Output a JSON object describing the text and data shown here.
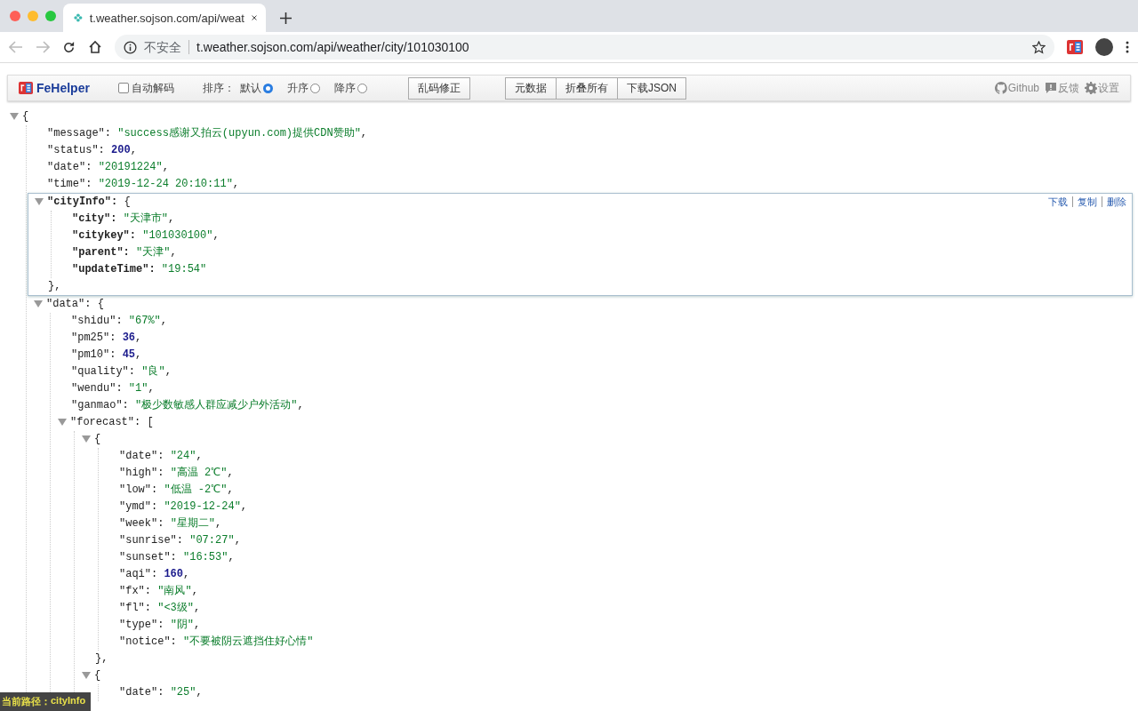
{
  "browser": {
    "tab": {
      "title": "t.weather.sojson.com/api/weat"
    },
    "security": "不安全",
    "url": "t.weather.sojson.com/api/weather/city/101030100"
  },
  "toolbar": {
    "logo": "FeHelper",
    "auto_decode": {
      "label": "自动解码",
      "checked": false
    },
    "sort": {
      "label": "排序：",
      "options": [
        {
          "label": "默认",
          "selected": true
        },
        {
          "label": "升序",
          "selected": false
        },
        {
          "label": "降序",
          "selected": false
        }
      ]
    },
    "fix_button": "乱码修正",
    "group_buttons": [
      "元数据",
      "折叠所有",
      "下载JSON"
    ],
    "links": [
      {
        "label": "Github",
        "kind": "github"
      },
      {
        "label": "反馈",
        "kind": "feedback"
      },
      {
        "label": "设置",
        "kind": "settings"
      }
    ]
  },
  "json": {
    "open": "{",
    "expanded": true,
    "selected": false,
    "children": [
      {
        "key": "\"message\":",
        "value": "\"success感谢又拍云(upyun.com)提供CDN赞助\"",
        "kind": "string",
        "tail": ","
      },
      {
        "key": "\"status\":",
        "value": "200",
        "kind": "number",
        "tail": ","
      },
      {
        "key": "\"date\":",
        "value": "\"20191224\"",
        "kind": "string",
        "tail": ","
      },
      {
        "key": "\"time\":",
        "value": "\"2019-12-24 20:10:11\"",
        "kind": "string",
        "tail": ","
      },
      {
        "key": "\"cityInfo\":",
        "open": "{",
        "expanded": true,
        "selected": true,
        "actions": [
          "下载",
          "复制",
          "删除"
        ],
        "close": "},",
        "children": [
          {
            "key": "\"city\":",
            "value": "\"天津市\"",
            "kind": "string",
            "tail": ","
          },
          {
            "key": "\"citykey\":",
            "value": "\"101030100\"",
            "kind": "string",
            "tail": ","
          },
          {
            "key": "\"parent\":",
            "value": "\"天津\"",
            "kind": "string",
            "tail": ","
          },
          {
            "key": "\"updateTime\":",
            "value": "\"19:54\"",
            "kind": "string"
          }
        ]
      },
      {
        "key": "\"data\":",
        "open": "{",
        "expanded": true,
        "selected": false,
        "children": [
          {
            "key": "\"shidu\":",
            "value": "\"67%\"",
            "kind": "string",
            "tail": ","
          },
          {
            "key": "\"pm25\":",
            "value": "36",
            "kind": "number",
            "tail": ","
          },
          {
            "key": "\"pm10\":",
            "value": "45",
            "kind": "number",
            "tail": ","
          },
          {
            "key": "\"quality\":",
            "value": "\"良\"",
            "kind": "string",
            "tail": ","
          },
          {
            "key": "\"wendu\":",
            "value": "\"1\"",
            "kind": "string",
            "tail": ","
          },
          {
            "key": "\"ganmao\":",
            "value": "\"极少数敏感人群应减少户外活动\"",
            "kind": "string",
            "tail": ","
          },
          {
            "key": "\"forecast\":",
            "open": "[",
            "expanded": true,
            "selected": false,
            "children": [
              {
                "open": "{",
                "expanded": true,
                "selected": false,
                "close": "},",
                "children": [
                  {
                    "key": "\"date\":",
                    "value": "\"24\"",
                    "kind": "string",
                    "tail": ","
                  },
                  {
                    "key": "\"high\":",
                    "value": "\"高温 2℃\"",
                    "kind": "string",
                    "tail": ","
                  },
                  {
                    "key": "\"low\":",
                    "value": "\"低温 -2℃\"",
                    "kind": "string",
                    "tail": ","
                  },
                  {
                    "key": "\"ymd\":",
                    "value": "\"2019-12-24\"",
                    "kind": "string",
                    "tail": ","
                  },
                  {
                    "key": "\"week\":",
                    "value": "\"星期二\"",
                    "kind": "string",
                    "tail": ","
                  },
                  {
                    "key": "\"sunrise\":",
                    "value": "\"07:27\"",
                    "kind": "string",
                    "tail": ","
                  },
                  {
                    "key": "\"sunset\":",
                    "value": "\"16:53\"",
                    "kind": "string",
                    "tail": ","
                  },
                  {
                    "key": "\"aqi\":",
                    "value": "160",
                    "kind": "number",
                    "tail": ","
                  },
                  {
                    "key": "\"fx\":",
                    "value": "\"南风\"",
                    "kind": "string",
                    "tail": ","
                  },
                  {
                    "key": "\"fl\":",
                    "value": "\"<3级\"",
                    "kind": "string",
                    "tail": ","
                  },
                  {
                    "key": "\"type\":",
                    "value": "\"阴\"",
                    "kind": "string",
                    "tail": ","
                  },
                  {
                    "key": "\"notice\":",
                    "value": "\"不要被阴云遮挡住好心情\"",
                    "kind": "string"
                  }
                ]
              },
              {
                "open": "{",
                "expanded": true,
                "selected": false,
                "children": [
                  {
                    "key": "\"date\":",
                    "value": "\"25\"",
                    "kind": "string",
                    "tail": ","
                  }
                ]
              }
            ]
          }
        ]
      }
    ]
  },
  "status_bar": {
    "label": "当前路径：",
    "path": "cityInfo"
  }
}
